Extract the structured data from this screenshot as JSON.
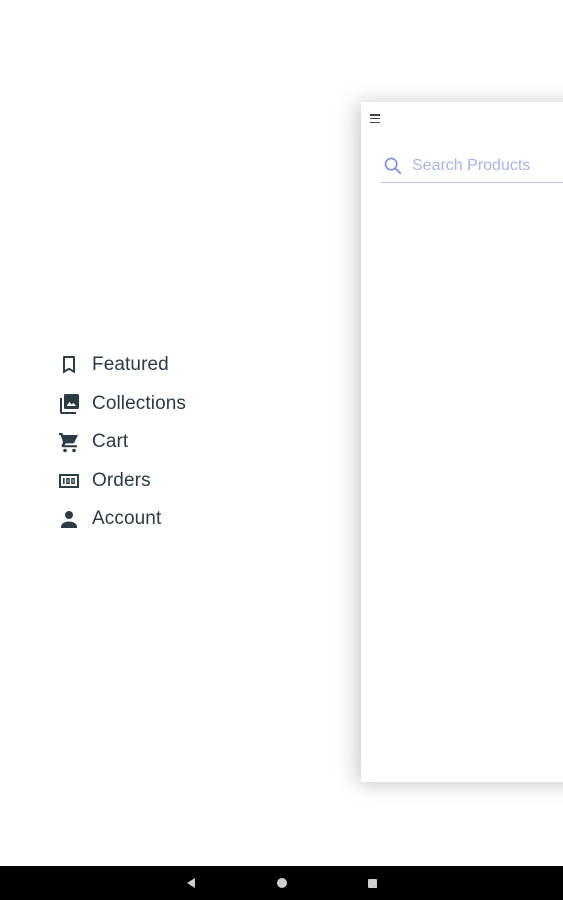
{
  "drawer": {
    "items": [
      {
        "label": "Featured",
        "icon": "bookmark-icon"
      },
      {
        "label": "Collections",
        "icon": "collections-icon"
      },
      {
        "label": "Cart",
        "icon": "cart-icon"
      },
      {
        "label": "Orders",
        "icon": "orders-icon"
      },
      {
        "label": "Account",
        "icon": "account-icon"
      }
    ]
  },
  "content": {
    "menu_icon": "hamburger-menu-icon",
    "search": {
      "placeholder": "Search Products",
      "value": "",
      "icon": "search-icon"
    }
  },
  "navigation_bar": {
    "buttons": [
      "back-icon",
      "home-icon",
      "recents-icon"
    ]
  },
  "colors": {
    "menu_text": "#2d3b44",
    "search_accent": "#a9b3e6",
    "nav_bar": "#000000"
  }
}
